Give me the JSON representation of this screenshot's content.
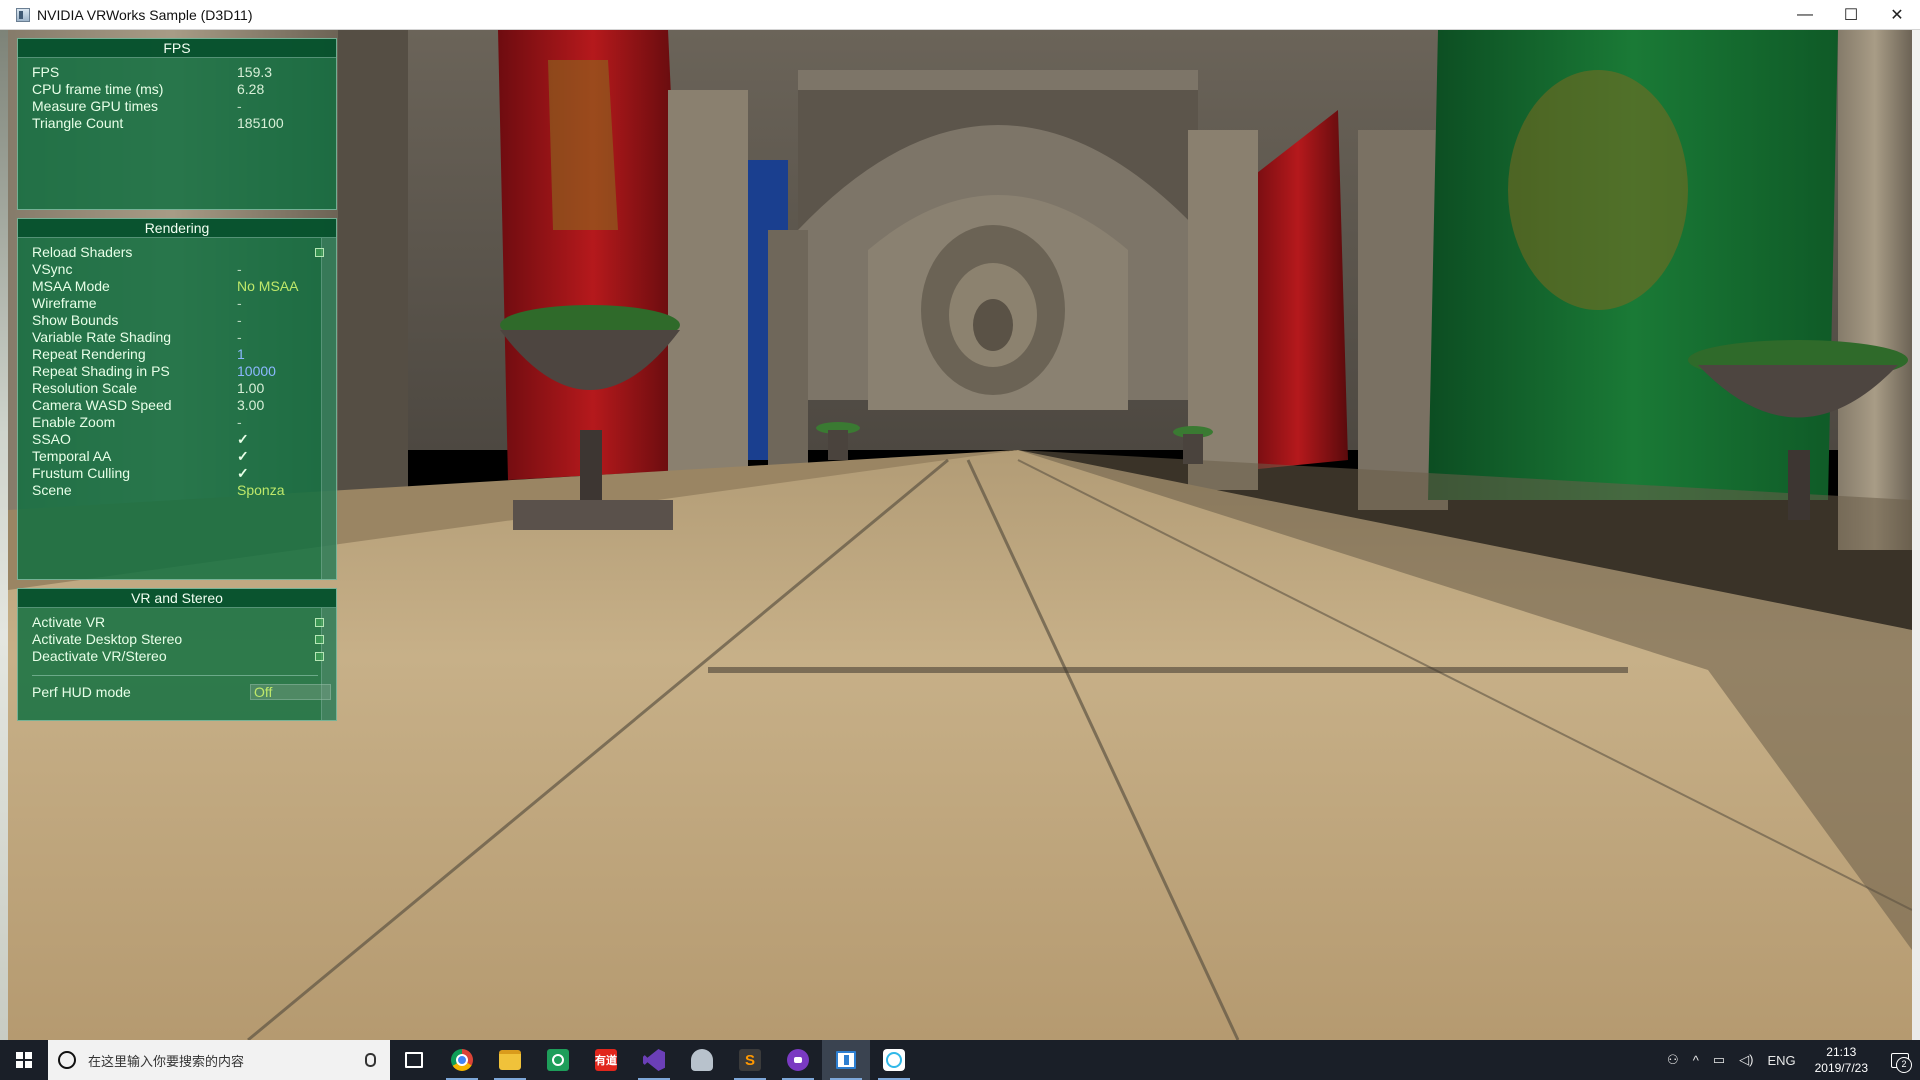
{
  "window": {
    "title": "NVIDIA VRWorks Sample (D3D11)",
    "controls": {
      "minimize": "—",
      "maximize": "☐",
      "close": "✕"
    }
  },
  "fps_panel": {
    "title": "FPS",
    "rows": [
      {
        "label": "FPS",
        "value": "159.3"
      },
      {
        "label": "CPU frame time (ms)",
        "value": "6.28"
      },
      {
        "label": "Measure GPU times",
        "value": "-"
      },
      {
        "label": "Triangle Count",
        "value": "185100"
      }
    ]
  },
  "rendering_panel": {
    "title": "Rendering",
    "rows": [
      {
        "label": "Reload Shaders",
        "value": ""
      },
      {
        "label": "VSync",
        "value": "-"
      },
      {
        "label": "MSAA Mode",
        "value": "No MSAA"
      },
      {
        "label": "Wireframe",
        "value": "-"
      },
      {
        "label": "Show Bounds",
        "value": "-"
      },
      {
        "label": "Variable Rate Shading",
        "value": "-"
      },
      {
        "label": "Repeat Rendering",
        "value": "1"
      },
      {
        "label": "Repeat Shading in PS",
        "value": "10000"
      },
      {
        "label": "Resolution Scale",
        "value": "1.00"
      },
      {
        "label": "Camera WASD Speed",
        "value": "3.00"
      },
      {
        "label": "Enable Zoom",
        "value": "-"
      },
      {
        "label": "SSAO",
        "value": "✓"
      },
      {
        "label": "Temporal AA",
        "value": "✓"
      },
      {
        "label": "Frustum Culling",
        "value": "✓"
      },
      {
        "label": "Scene",
        "value": "Sponza"
      }
    ]
  },
  "vr_panel": {
    "title": "VR and Stereo",
    "rows": [
      {
        "label": "Activate VR"
      },
      {
        "label": "Activate Desktop Stereo"
      },
      {
        "label": "Deactivate VR/Stereo"
      }
    ],
    "perf_label": "Perf HUD mode",
    "perf_value": "Off"
  },
  "taskbar": {
    "search_placeholder": "在这里输入你要搜索的内容",
    "apps": [
      {
        "name": "task-view-icon",
        "glyph": "▭"
      },
      {
        "name": "chrome-icon",
        "glyph": ""
      },
      {
        "name": "file-explorer-icon",
        "glyph": ""
      },
      {
        "name": "contacts-app-icon",
        "glyph": ""
      },
      {
        "name": "youdao-dict-icon",
        "glyph": "有道"
      },
      {
        "name": "visual-studio-icon",
        "glyph": ""
      },
      {
        "name": "network-app-icon",
        "glyph": ""
      },
      {
        "name": "sublime-text-icon",
        "glyph": "S"
      },
      {
        "name": "media-app-icon",
        "glyph": ""
      },
      {
        "name": "vrworks-sample-icon",
        "glyph": ""
      },
      {
        "name": "chat-app-icon",
        "glyph": ""
      }
    ],
    "tray": {
      "language": "ENG",
      "time": "21:13",
      "date": "2019/7/23",
      "notification_count": "2"
    }
  }
}
